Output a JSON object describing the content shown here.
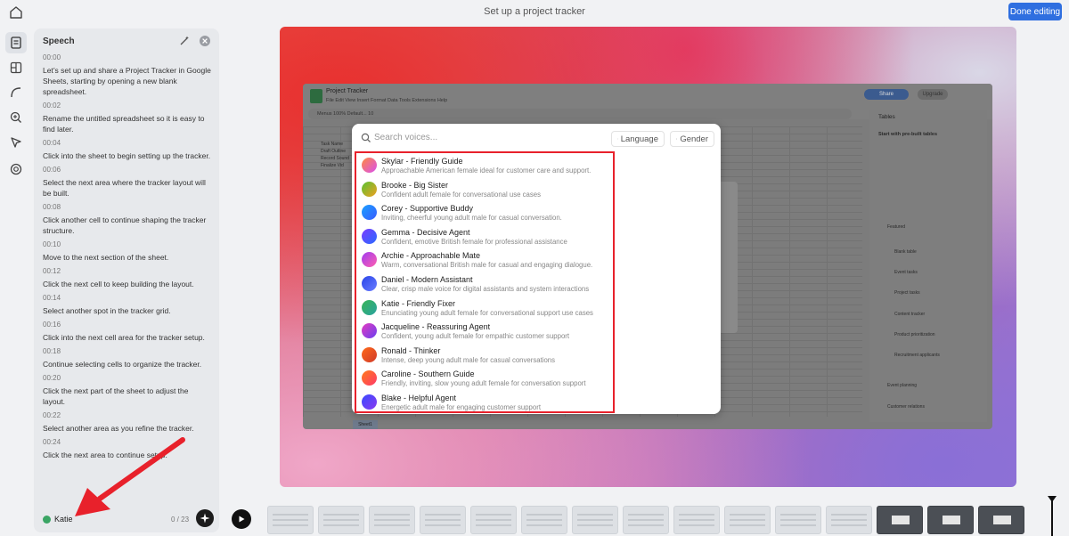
{
  "header": {
    "title": "Set up a project tracker",
    "done_label": "Done editing"
  },
  "speech_panel": {
    "title": "Speech",
    "segments": [
      {
        "time": "00:00",
        "text": "Let’s set up and share a Project Tracker in Google Sheets, starting by opening a new blank spreadsheet."
      },
      {
        "time": "00:02",
        "text": "Rename the untitled spreadsheet so it is easy to find later."
      },
      {
        "time": "00:04",
        "text": "Click into the sheet to begin setting up the tracker."
      },
      {
        "time": "00:06",
        "text": "Select the next area where the tracker layout will be built."
      },
      {
        "time": "00:08",
        "text": "Click another cell to continue shaping the tracker structure."
      },
      {
        "time": "00:10",
        "text": "Move to the next section of the sheet."
      },
      {
        "time": "00:12",
        "text": "Click the next cell to keep building the layout."
      },
      {
        "time": "00:14",
        "text": "Select another spot in the tracker grid."
      },
      {
        "time": "00:16",
        "text": "Click into the next cell area for the tracker setup."
      },
      {
        "time": "00:18",
        "text": "Continue selecting cells to organize the tracker."
      },
      {
        "time": "00:20",
        "text": "Click the next part of the sheet to adjust the layout."
      },
      {
        "time": "00:22",
        "text": "Select another area as you refine the tracker."
      },
      {
        "time": "00:24",
        "text": "Click the next area to continue setup."
      }
    ],
    "voice_name": "Katie",
    "count": "0 / 23"
  },
  "sheets_window": {
    "doc_name": "Project Tracker",
    "menu": "File   Edit   View   Insert   Format   Data   Tools   Extensions   Help",
    "toolbar": "Menus          100%          Default...     10",
    "share_label": "Share",
    "upgrade_label": "Upgrade",
    "cells": [
      "Task Name",
      "Draft Outline",
      "Record Sound",
      "Finalize Vid"
    ],
    "side_title": "Tables",
    "side_sub": "Start with pre-built tables",
    "side_featured": "Featured",
    "side_items": [
      "Blank table",
      "Event tasks",
      "Project tasks",
      "Content tracker",
      "Product prioritization",
      "Recruitment applicants"
    ],
    "side_footer": [
      "Event planning",
      "Customer relations"
    ],
    "sheet_tab": "Sheet1"
  },
  "voice_picker": {
    "search_placeholder": "Search voices...",
    "language_label": "Language",
    "gender_label": "Gender",
    "voices": [
      {
        "name": "Skylar - Friendly Guide",
        "desc": "Approachable American female ideal for customer care and support."
      },
      {
        "name": "Brooke - Big Sister",
        "desc": "Confident adult female for conversational use cases"
      },
      {
        "name": "Corey - Supportive Buddy",
        "desc": "Inviting, cheerful young adult male for casual conversation."
      },
      {
        "name": "Gemma - Decisive Agent",
        "desc": "Confident, emotive British female for professional assistance"
      },
      {
        "name": "Archie - Approachable Mate",
        "desc": "Warm, conversational British male for casual and engaging dialogue."
      },
      {
        "name": "Daniel - Modern Assistant",
        "desc": "Clear, crisp male voice for digital assistants and system interactions"
      },
      {
        "name": "Katie - Friendly Fixer",
        "desc": "Enunciating young adult female for conversational support use cases"
      },
      {
        "name": "Jacqueline - Reassuring Agent",
        "desc": "Confident, young adult female for empathic customer support"
      },
      {
        "name": "Ronald - Thinker",
        "desc": "Intense, deep young adult male for casual conversations"
      },
      {
        "name": "Caroline - Southern Guide",
        "desc": "Friendly, inviting, slow young adult female for conversation support"
      },
      {
        "name": "Blake - Helpful Agent",
        "desc": "Energetic adult male for engaging customer support"
      }
    ],
    "avatar_colors": [
      [
        "#ff8a3d",
        "#d94ff0"
      ],
      [
        "#58c232",
        "#f0a020"
      ],
      [
        "#1aa1ff",
        "#3a5cff"
      ],
      [
        "#7a3cff",
        "#2a6bff"
      ],
      [
        "#a13cf0",
        "#ff5fb0"
      ],
      [
        "#2a45e8",
        "#6a7dff"
      ],
      [
        "#38b456",
        "#2aa3a0"
      ],
      [
        "#e33cc0",
        "#6a3ff0"
      ],
      [
        "#ff6a1a",
        "#d03a2a"
      ],
      [
        "#ff7a1a",
        "#ff3a6a"
      ],
      [
        "#3a4aff",
        "#8a3af0"
      ]
    ]
  },
  "colors": {
    "accent": "#2f6fe0",
    "highlight": "#e8212b",
    "voice_dot": "#3aa564"
  }
}
